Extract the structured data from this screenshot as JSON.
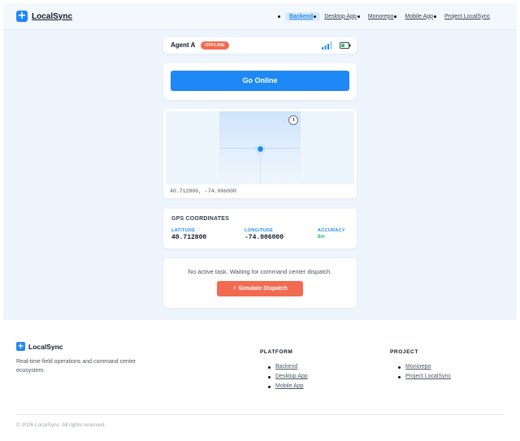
{
  "brand": {
    "name": "LocalSync",
    "logo_glyph": "+"
  },
  "nav": {
    "items": [
      {
        "label": "Backend",
        "active": true
      },
      {
        "label": "Desktop App",
        "active": false
      },
      {
        "label": "Monorepo",
        "active": false
      },
      {
        "label": "Mobile App",
        "active": false
      },
      {
        "label": "Project LocalSync",
        "active": false
      }
    ]
  },
  "agent": {
    "name": "Agent A",
    "status": "OFFLINE",
    "signal_icon": "signal-bars-icon",
    "battery_icon": "battery-icon"
  },
  "actions": {
    "go_online_label": "Go Online"
  },
  "map": {
    "coords_text": "40.712800, -74.006000",
    "compass_icon": "compass-icon"
  },
  "gps": {
    "title": "GPS COORDINATES",
    "latitude_label": "LATITUDE",
    "latitude_value": "40.712800",
    "longitude_label": "LONGITUDE",
    "longitude_value": "-74.006000",
    "accuracy_label": "ACCURACY",
    "accuracy_value": "8m"
  },
  "dispatch": {
    "message": "No active task. Waiting for command center dispatch.",
    "simulate_label": "⚡ Simulate Dispatch"
  },
  "footer": {
    "brand_name": "LocalSync",
    "tagline": "Real-time field operations and command center ecosystem.",
    "platform_heading": "PLATFORM",
    "platform_links": [
      "Backend",
      "Desktop App",
      "Mobile App"
    ],
    "project_heading": "PROJECT",
    "project_links": [
      "Monorepo",
      "Project LocalSync"
    ],
    "copyright": "© 2026 LocalSync. All rights reserved."
  },
  "colors": {
    "accent": "#1e88f5",
    "offline": "#f26a4f",
    "accuracy": "#22c55e",
    "page_bg": "#eef5fc"
  }
}
